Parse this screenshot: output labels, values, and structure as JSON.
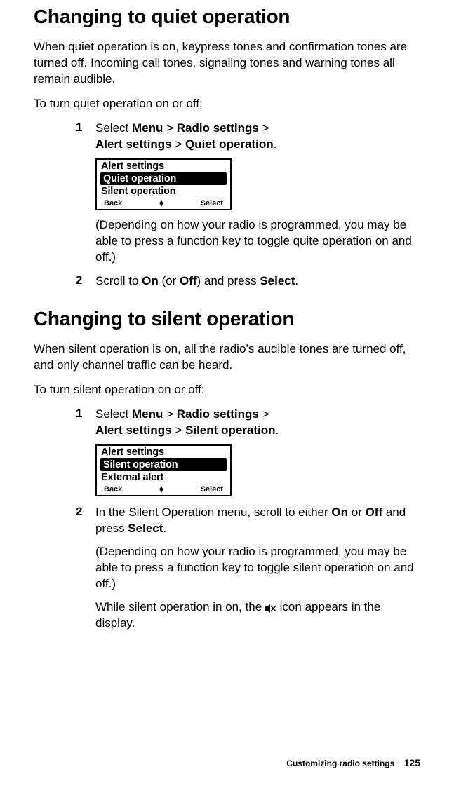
{
  "section1": {
    "heading": "Changing to quiet operation",
    "intro": "When quiet operation is on, keypress tones and confirmation tones are turned off. Incoming call tones, signaling tones and warning tones all remain audible.",
    "instruction": "To turn quiet operation on or off:",
    "step1_num": "1",
    "step1_prefix": "Select ",
    "step1_menu": "Menu",
    "step1_sep1": " > ",
    "step1_radio": "Radio settings",
    "step1_sep2": " > ",
    "step1_alert": "Alert settings",
    "step1_sep3": " > ",
    "step1_quiet": "Quiet operation",
    "step1_period": ".",
    "lcd1": {
      "title": "Alert settings",
      "highlight": " Quiet operation",
      "row2": " Silent operation",
      "back": "Back",
      "select": "Select"
    },
    "step1_note": "(Depending on how your radio is programmed, you may be able to press a function key to toggle quite operation on and off.)",
    "step2_num": "2",
    "step2_prefix": "Scroll to ",
    "step2_on": "On",
    "step2_mid": " (or ",
    "step2_off": "Off",
    "step2_mid2": ") and press ",
    "step2_select": "Select",
    "step2_period": "."
  },
  "section2": {
    "heading": "Changing to silent operation",
    "intro": "When silent operation is on, all the radio’s audible tones are turned off, and only channel traffic can be heard.",
    "instruction": "To turn silent operation on or off:",
    "step1_num": "1",
    "step1_prefix": "Select ",
    "step1_menu": "Menu",
    "step1_sep1": " > ",
    "step1_radio": "Radio settings",
    "step1_sep2": " > ",
    "step1_alert": "Alert settings",
    "step1_sep3": " > ",
    "step1_silent": "Silent operation",
    "step1_period": ".",
    "lcd2": {
      "title": "Alert settings",
      "highlight": " Silent operation",
      "row2": " External alert",
      "back": "Back",
      "select": "Select"
    },
    "step2_num": "2",
    "step2_prefix": "In the Silent Operation menu, scroll to either ",
    "step2_on": "On",
    "step2_mid": " or ",
    "step2_off": "Off",
    "step2_mid2": " and press ",
    "step2_select": "Select",
    "step2_period": ".",
    "step2_note": "(Depending on how your radio is programmed, you may be able to press a function key to toggle silent operation on and off.)",
    "icon_note_prefix": "While silent operation in on, the ",
    "icon_note_suffix": " icon appears in the display."
  },
  "footer": {
    "label": "Customizing radio settings",
    "page": "125"
  }
}
